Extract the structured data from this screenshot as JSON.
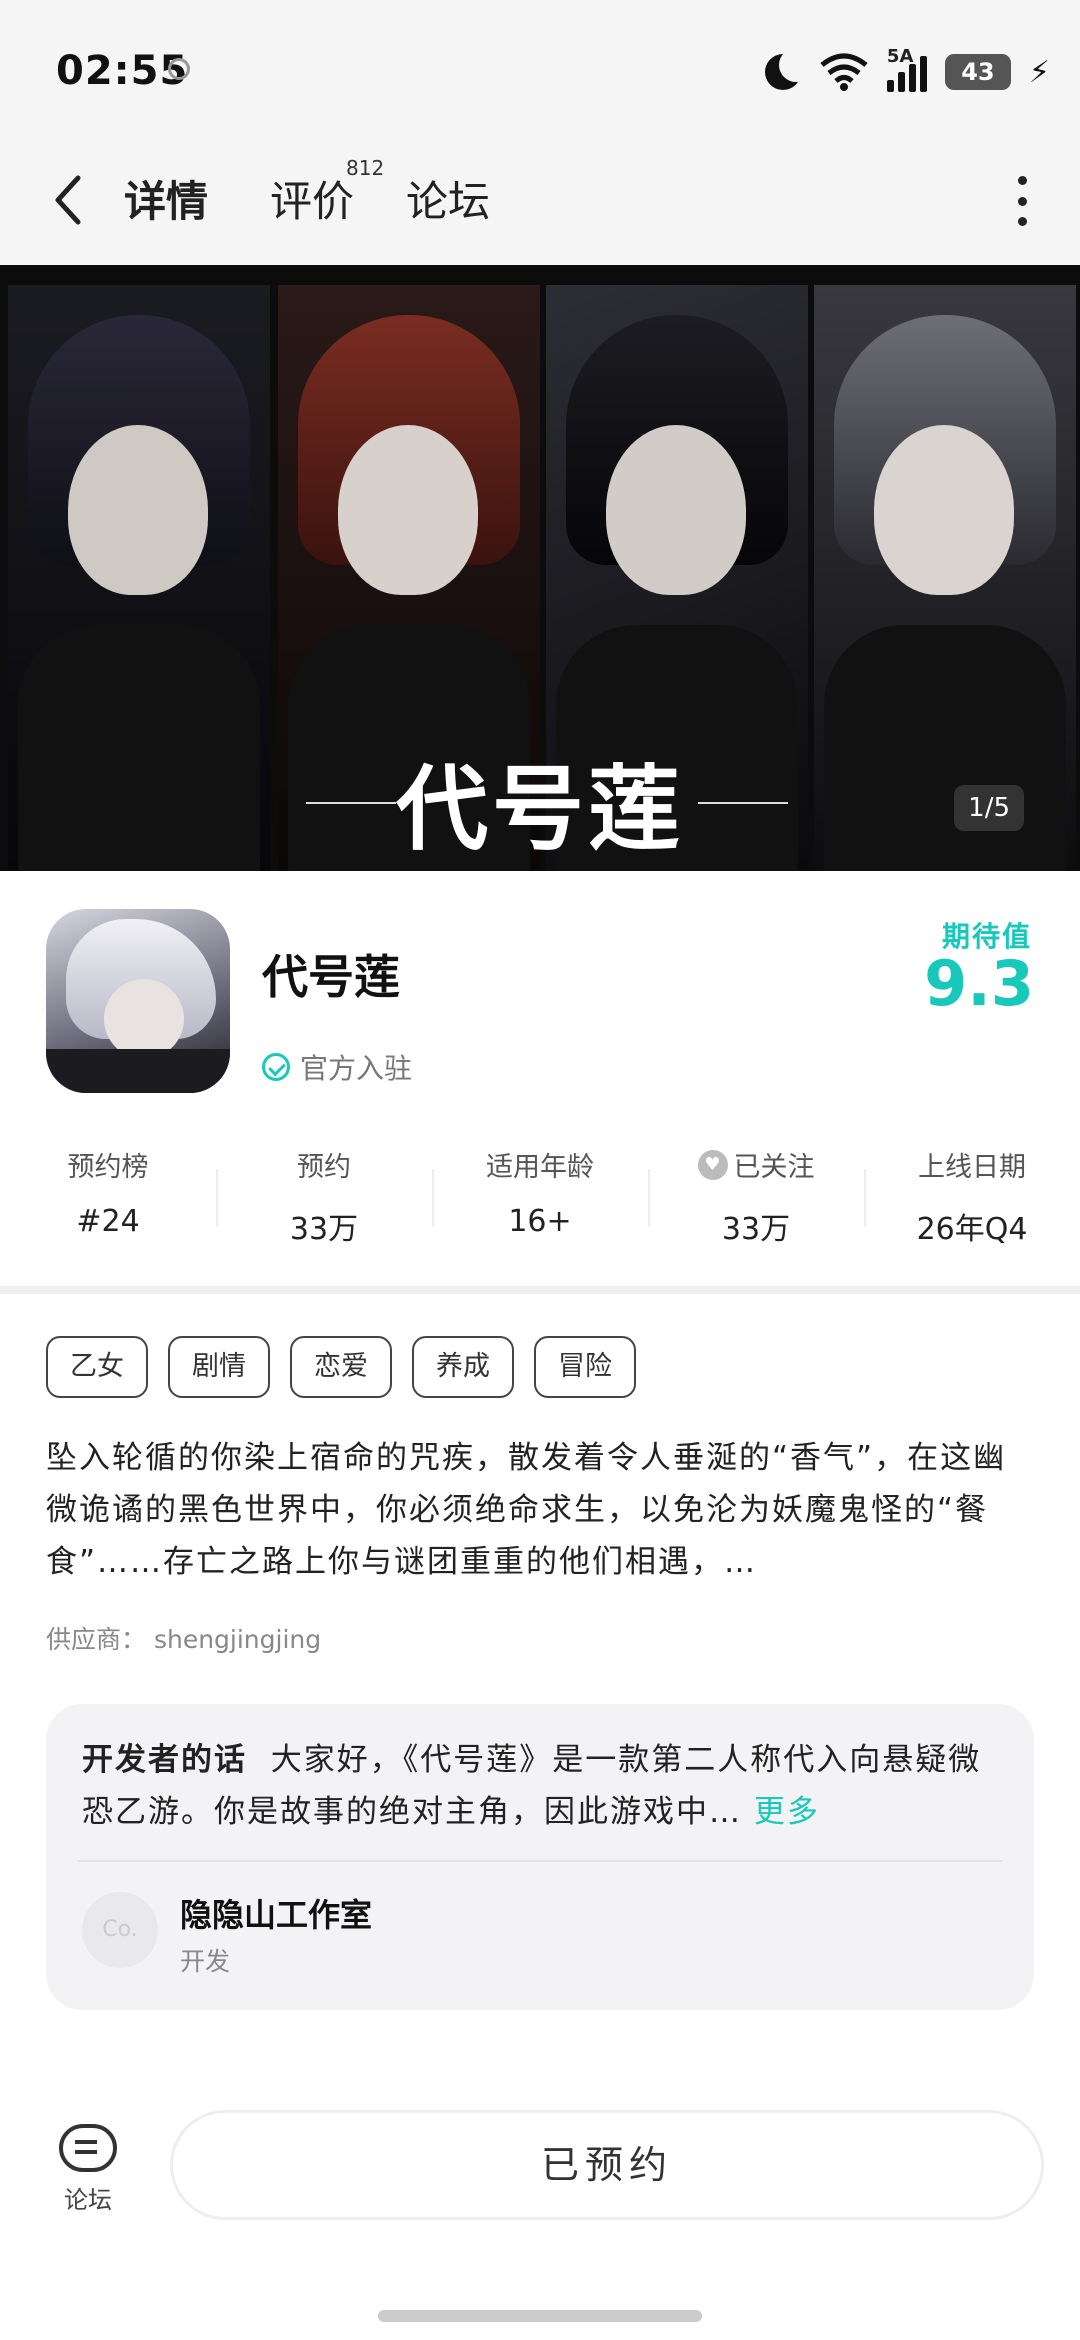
{
  "status": {
    "time": "02:55",
    "network": "5A",
    "battery": "43"
  },
  "nav": {
    "tabs": [
      {
        "label": "详情"
      },
      {
        "label": "评价"
      },
      {
        "label": "论坛"
      }
    ],
    "review_count": "812"
  },
  "banner": {
    "title": "代号莲",
    "counter": "1/5"
  },
  "app": {
    "name": "代号莲",
    "official_label": "官方入驻",
    "expect_label": "期待值",
    "expect_value": "9.3"
  },
  "stats": [
    {
      "label": "预约榜",
      "value": "#24"
    },
    {
      "label": "预约",
      "value": "33万"
    },
    {
      "label": "适用年龄",
      "value": "16+"
    },
    {
      "label": "已关注",
      "value": "33万"
    },
    {
      "label": "上线日期",
      "value": "26年Q4"
    }
  ],
  "tags": [
    "乙女",
    "剧情",
    "恋爱",
    "养成",
    "冒险"
  ],
  "description": "坠入轮循的你染上宿命的咒疾，散发着令人垂涎的“香气”，在这幽微诡谲的黑色世界中，你必须绝命求生，以免沦为妖魔鬼怪的“餐食”……存亡之路上你与谜团重重的他们相遇，…",
  "supplier": "供应商：  shengjingjing",
  "developer": {
    "heading": "开发者的话",
    "text": "大家好，《代号莲》是一款第二人称代入向悬疑微恐乙游。你是故事的绝对主角，因此游戏中…",
    "more": "更多",
    "avatar": "Co.",
    "name": "隐隐山工作室",
    "role": "开发"
  },
  "bottom": {
    "forum_label": "论坛",
    "reserve_label": "已预约"
  }
}
